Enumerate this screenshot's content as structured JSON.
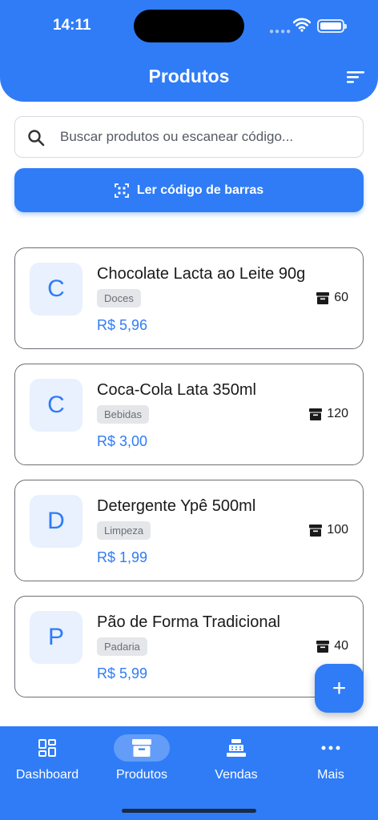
{
  "status_bar": {
    "time": "14:11"
  },
  "header": {
    "title": "Produtos"
  },
  "search": {
    "placeholder": "Buscar produtos ou escanear código..."
  },
  "scan_button": {
    "label": "Ler código de barras"
  },
  "products": [
    {
      "initial": "C",
      "name": "Chocolate Lacta ao Leite 90g",
      "category": "Doces",
      "price": "R$ 5,96",
      "stock": "60"
    },
    {
      "initial": "C",
      "name": "Coca-Cola Lata 350ml",
      "category": "Bebidas",
      "price": "R$ 3,00",
      "stock": "120"
    },
    {
      "initial": "D",
      "name": "Detergente Ypê 500ml",
      "category": "Limpeza",
      "price": "R$ 1,99",
      "stock": "100"
    },
    {
      "initial": "P",
      "name": "Pão de Forma Tradicional",
      "category": "Padaria",
      "price": "R$ 5,99",
      "stock": "40"
    }
  ],
  "fab": {
    "symbol": "+"
  },
  "nav": {
    "items": [
      {
        "label": "Dashboard",
        "icon": "dashboard-icon"
      },
      {
        "label": "Produtos",
        "icon": "inventory-icon",
        "active": true
      },
      {
        "label": "Vendas",
        "icon": "cash-register-icon"
      },
      {
        "label": "Mais",
        "icon": "more-dots-icon"
      }
    ]
  },
  "colors": {
    "primary": "#2f7cf6",
    "avatar_bg": "#e8f1fd",
    "badge_bg": "#e4e6ea"
  }
}
